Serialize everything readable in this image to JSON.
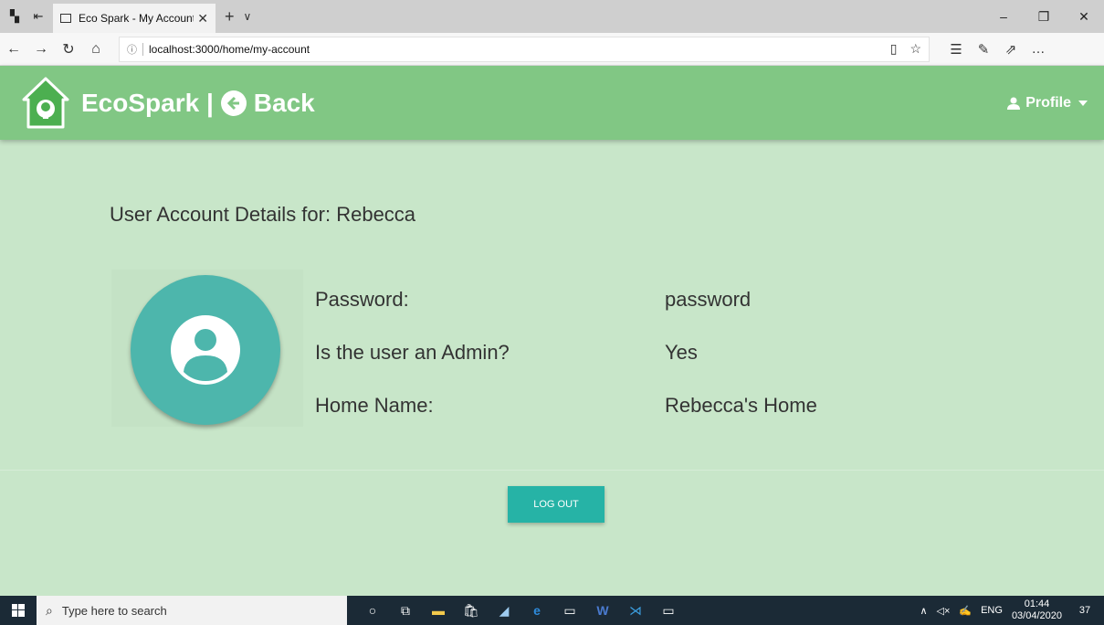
{
  "browser": {
    "tab_title": "Eco Spark - My Account",
    "url": "localhost:3000/home/my-account"
  },
  "header": {
    "brand": "EcoSpark |",
    "back_label": "Back",
    "profile_label": "Profile"
  },
  "account": {
    "heading": "User Account Details for: Rebecca",
    "fields": [
      {
        "label": "Password:",
        "value": "password"
      },
      {
        "label": "Is the user an Admin?",
        "value": "Yes"
      },
      {
        "label": "Home Name:",
        "value": "Rebecca's Home"
      }
    ]
  },
  "actions": {
    "logout_label": "LOG OUT"
  },
  "taskbar": {
    "search_placeholder": "Type here to search",
    "lang": "ENG",
    "time": "01:44",
    "date": "03/04/2020",
    "notifications": "37"
  },
  "colors": {
    "header": "#81c784",
    "background": "#c8e6c9",
    "avatar": "#4db6ac",
    "logout_button": "#26b3a6"
  },
  "icons": [
    "home-logo-icon",
    "back-arrow-icon",
    "user-icon",
    "avatar-user-icon"
  ]
}
